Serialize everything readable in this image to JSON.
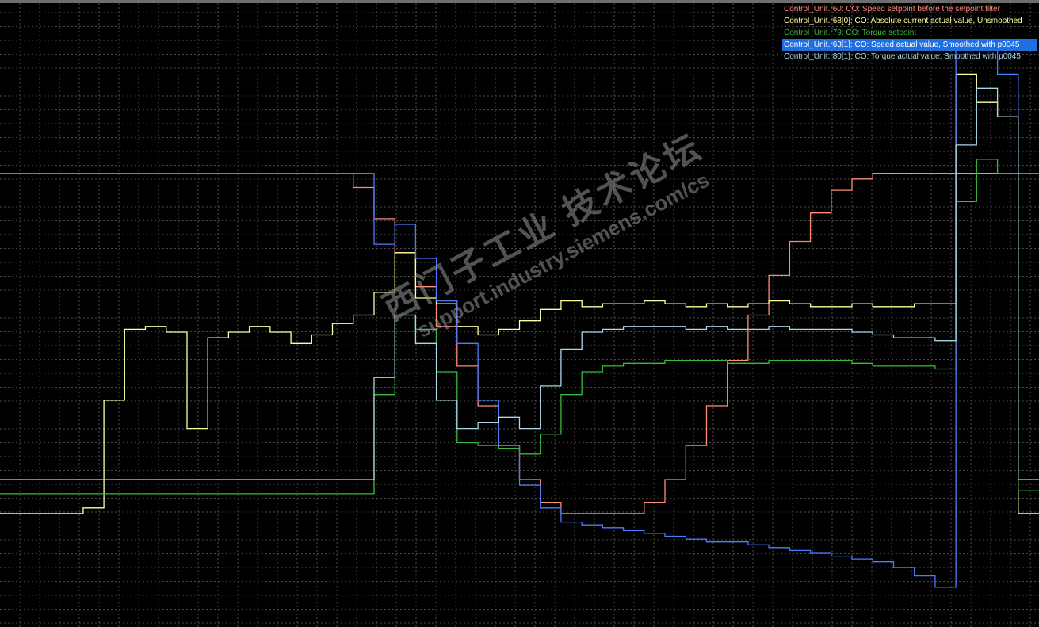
{
  "colors": {
    "background": "#000000",
    "grid": "#4a4a4a"
  },
  "watermark": {
    "line1": "西门子工业 技术论坛",
    "line2": "support.industry.siemens.com/cs"
  },
  "chart_data": {
    "type": "line",
    "grid": true,
    "legend_position": "top-right",
    "x": [
      0,
      4,
      8,
      12,
      16,
      20,
      24,
      28,
      32,
      36,
      40,
      44,
      48,
      52,
      56,
      60,
      64,
      68,
      72,
      76,
      80,
      84,
      88,
      92,
      96,
      100,
      104,
      108,
      112,
      116,
      120,
      124,
      128,
      132,
      136,
      140,
      144,
      148,
      152,
      156,
      160,
      164,
      168,
      172,
      176,
      180,
      184,
      188,
      192,
      196,
      200
    ],
    "xlim": [
      0,
      200
    ],
    "ylim": [
      -110,
      110
    ],
    "selected_series": 3,
    "series": [
      {
        "name": "Control_Unit.r60: CO: Speed setpoint before the setpoint filter",
        "color": "#ff8c78",
        "values": [
          50,
          50,
          50,
          50,
          50,
          50,
          50,
          50,
          50,
          50,
          50,
          50,
          50,
          50,
          50,
          50,
          50,
          45,
          34,
          22,
          10,
          -4,
          -18,
          -32,
          -46,
          -58,
          -66,
          -70,
          -70,
          -70,
          -70,
          -66,
          -58,
          -46,
          -32,
          -16,
          0,
          14,
          26,
          36,
          44,
          48,
          50,
          50,
          50,
          50,
          50,
          50,
          50,
          50,
          50
        ]
      },
      {
        "name": "Control_Unit.r68[0]: CO: Absolute current actual value, Unsmoothed",
        "color": "#ffffa0",
        "values": [
          -70,
          -70,
          -70,
          -70,
          -68,
          -30,
          -5,
          -4,
          -6,
          -40,
          -8,
          -6,
          -4,
          -6,
          -10,
          -7,
          -3,
          0,
          8,
          22,
          6,
          4,
          -4,
          -7,
          -5,
          -2,
          2,
          5,
          3,
          4,
          4,
          5,
          4,
          3,
          4,
          3,
          4,
          5,
          4,
          3,
          3,
          4,
          3,
          3,
          4,
          4,
          85,
          75,
          70,
          -70,
          -70
        ]
      },
      {
        "name": "Control_Unit.r79: CO: Torque setpoint",
        "color": "#3cb83c",
        "values": [
          -63,
          -63,
          -63,
          -63,
          -63,
          -63,
          -63,
          -63,
          -63,
          -63,
          -63,
          -63,
          -63,
          -63,
          -63,
          -63,
          -63,
          -63,
          -28,
          0,
          -5,
          -20,
          -45,
          -46,
          -47,
          -49,
          -42,
          -28,
          -20,
          -18,
          -17,
          -17,
          -16,
          -16,
          -16,
          -17,
          -17,
          -16,
          -16,
          -16,
          -16,
          -17,
          -18,
          -18,
          -18,
          -19,
          40,
          55,
          50,
          -62,
          -62
        ]
      },
      {
        "name": "Control_Unit.r63[1]: CO: Speed actual value, Smoothed with p0045",
        "color": "#4c7cff",
        "values": [
          50,
          50,
          50,
          50,
          50,
          50,
          50,
          50,
          50,
          50,
          50,
          50,
          50,
          50,
          50,
          50,
          50,
          50,
          25,
          32,
          20,
          5,
          -10,
          -30,
          -46,
          -60,
          -68,
          -73,
          -74,
          -75,
          -76,
          -77,
          -78,
          -79,
          -80,
          -80,
          -81,
          -82,
          -83,
          -84,
          -85,
          -86,
          -87,
          -89,
          -92,
          -96,
          95,
          95,
          85,
          50,
          50
        ]
      },
      {
        "name": "Control_Unit.r80[1]: CO: Torque actual value, Smoothed with p0045",
        "color": "#a8d8e8",
        "values": [
          -58,
          -58,
          -58,
          -58,
          -58,
          -58,
          -58,
          -58,
          -58,
          -58,
          -58,
          -58,
          -58,
          -58,
          -58,
          -58,
          -58,
          -58,
          -22,
          0,
          -10,
          -30,
          -40,
          -38,
          -36,
          -40,
          -25,
          -12,
          -6,
          -5,
          -4,
          -4,
          -4,
          -5,
          -4,
          -5,
          -5,
          -4,
          -5,
          -5,
          -5,
          -6,
          -7,
          -8,
          -8,
          -9,
          60,
          80,
          70,
          -58,
          -58
        ]
      }
    ]
  }
}
